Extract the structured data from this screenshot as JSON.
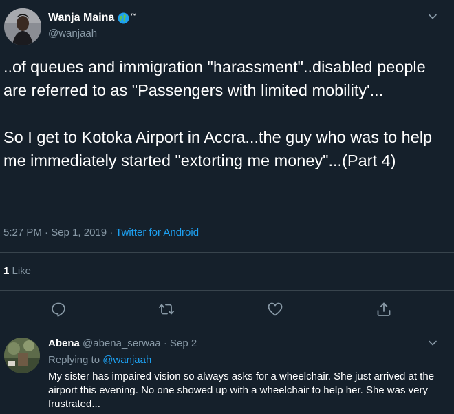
{
  "tweet": {
    "author_name": "Wanja Maina",
    "author_badge": "™",
    "handle": "@wanjaah",
    "text": "..of queues and immigration \"harassment\"..disabled people are referred to as \"Passengers with limited mobility'...\n\nSo I get to Kotoka Airport in Accra...the guy who was to help me immediately started \"extorting me money\"...(Part 4)",
    "time": "5:27 PM · Sep 1, 2019 · ",
    "source": "Twitter for Android",
    "like_count": "1",
    "like_label": " Like",
    "icons": [
      "reply-icon",
      "retweet-icon",
      "like-icon",
      "share-icon"
    ]
  },
  "reply": {
    "author_name": "Abena",
    "handle_date": " @abena_serwaa · Sep 2",
    "replying_to_label": "Replying to ",
    "replying_to_handle": "@wanjaah",
    "text": "My sister has impaired vision so always asks for a wheelchair. She just arrived at the airport this evening. No one showed up with a wheelchair to help her. She was very frustrated..."
  },
  "colors": {
    "background": "#15202b",
    "text_secondary": "#8899a6",
    "accent": "#1da1f2",
    "divider": "#38444d"
  }
}
